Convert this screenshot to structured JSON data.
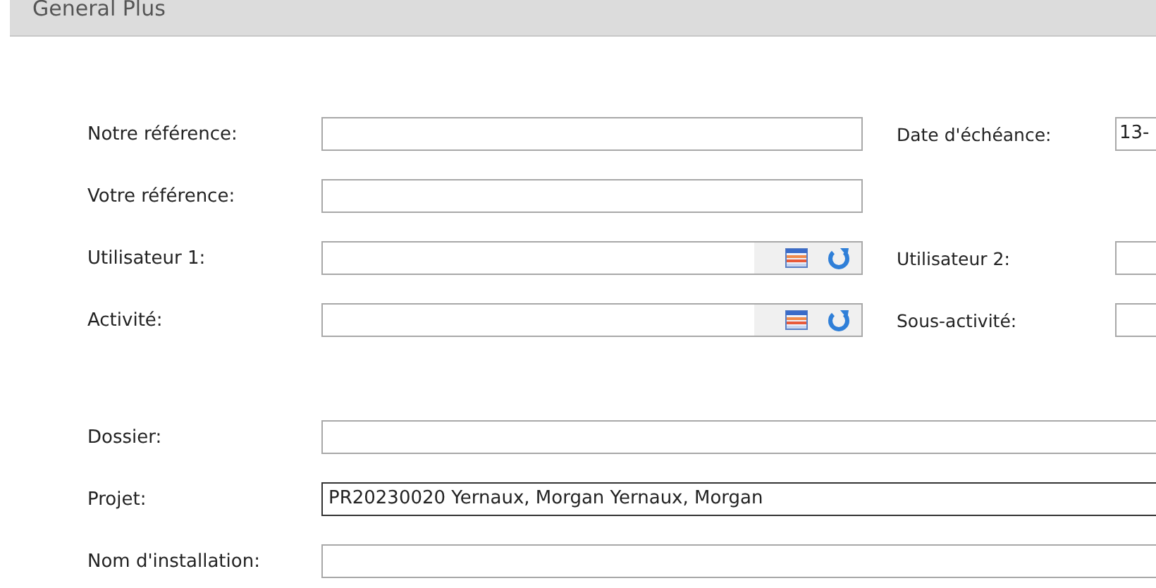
{
  "tab": {
    "title": "General Plus"
  },
  "sections": [
    {
      "rows": [
        {
          "label": "Notre référence:",
          "field": {
            "kind": "text",
            "focused": false
          },
          "right": {
            "label": "Date d'échéance:",
            "value": "13-"
          }
        },
        {
          "label": "Votre référence:",
          "field": {
            "kind": "text",
            "focused": false
          }
        },
        {
          "label": "Utilisateur 1:",
          "field": {
            "kind": "lookup",
            "focused": false
          },
          "right": {
            "label": "Utilisateur 2:"
          }
        },
        {
          "label": "Activité:",
          "field": {
            "kind": "lookup",
            "focused": false
          },
          "right": {
            "label": "Sous-activité:"
          }
        }
      ]
    },
    {
      "rows": [
        {
          "label": "Dossier:",
          "field": {
            "kind": "wide",
            "focused": false
          }
        },
        {
          "label": "Projet:",
          "field": {
            "kind": "wide",
            "value": "PR20230020 Yernaux, Morgan Yernaux, Morgan",
            "focused": true
          }
        },
        {
          "label": "Nom d'installation:",
          "field": {
            "kind": "wide",
            "focused": false
          }
        }
      ]
    }
  ]
}
